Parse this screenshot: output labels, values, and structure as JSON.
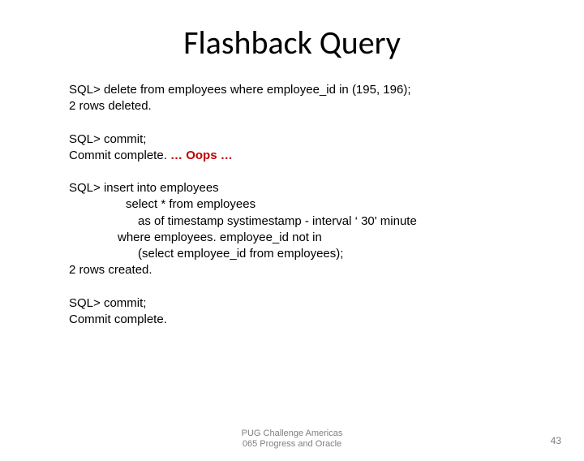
{
  "title": "Flashback Query",
  "block1": {
    "l1": "SQL> delete from employees where employee_id in (195, 196);",
    "l2": "2 rows deleted."
  },
  "block2": {
    "l1": "SQL> commit;",
    "l2a": "Commit complete. ",
    "l2b": "… Oops …"
  },
  "block3": {
    "l1": "SQL> insert into employees",
    "l2": "select * from employees",
    "l3": "as of timestamp systimestamp - interval ‘ 30' minute",
    "l4": "where employees. employee_id not in",
    "l5": "(select employee_id from employees);",
    "l6": "2 rows created."
  },
  "block4": {
    "l1": "SQL> commit;",
    "l2": "Commit complete."
  },
  "footer": {
    "line1": "PUG Challenge Americas",
    "line2": "065 Progress and Oracle",
    "page": "43"
  }
}
